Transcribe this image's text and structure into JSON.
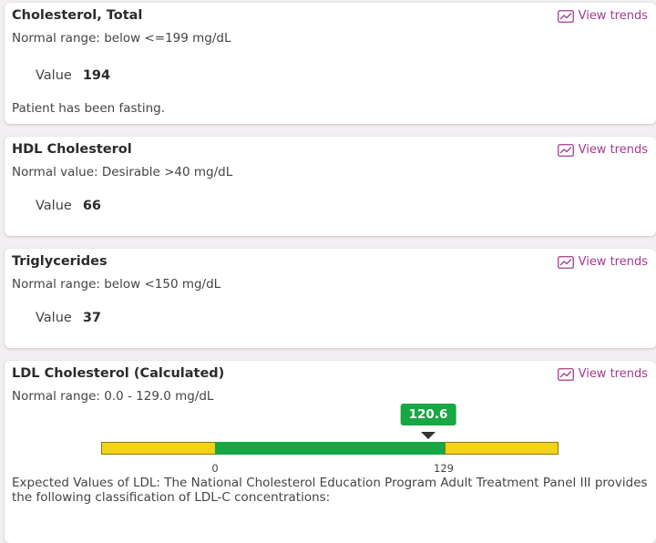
{
  "trends_label": "View trends",
  "cards": [
    {
      "title": "Cholesterol, Total",
      "range": "Normal range: below <=199 mg/dL",
      "value_label": "Value",
      "value": "194",
      "note": "Patient has been fasting."
    },
    {
      "title": "HDL Cholesterol",
      "range": "Normal value: Desirable >40 mg/dL",
      "value_label": "Value",
      "value": "66"
    },
    {
      "title": "Triglycerides",
      "range": "Normal range: below <150 mg/dL",
      "value_label": "Value",
      "value": "37"
    },
    {
      "title": "LDL Cholesterol (Calculated)",
      "range": "Normal range: 0.0 - 129.0 mg/dL",
      "gauge": {
        "value": "120.6",
        "low_tick": "0",
        "high_tick": "129"
      },
      "description": "Expected Values of LDL: The National Cholesterol Education Program Adult Treatment Panel III provides the following classification of LDL-C concentrations:"
    }
  ],
  "colors": {
    "accent": "#a23b8f",
    "in_range": "#17a745",
    "out_of_range": "#f2d21b"
  },
  "icons": {
    "trends": "trend-chart-icon"
  }
}
